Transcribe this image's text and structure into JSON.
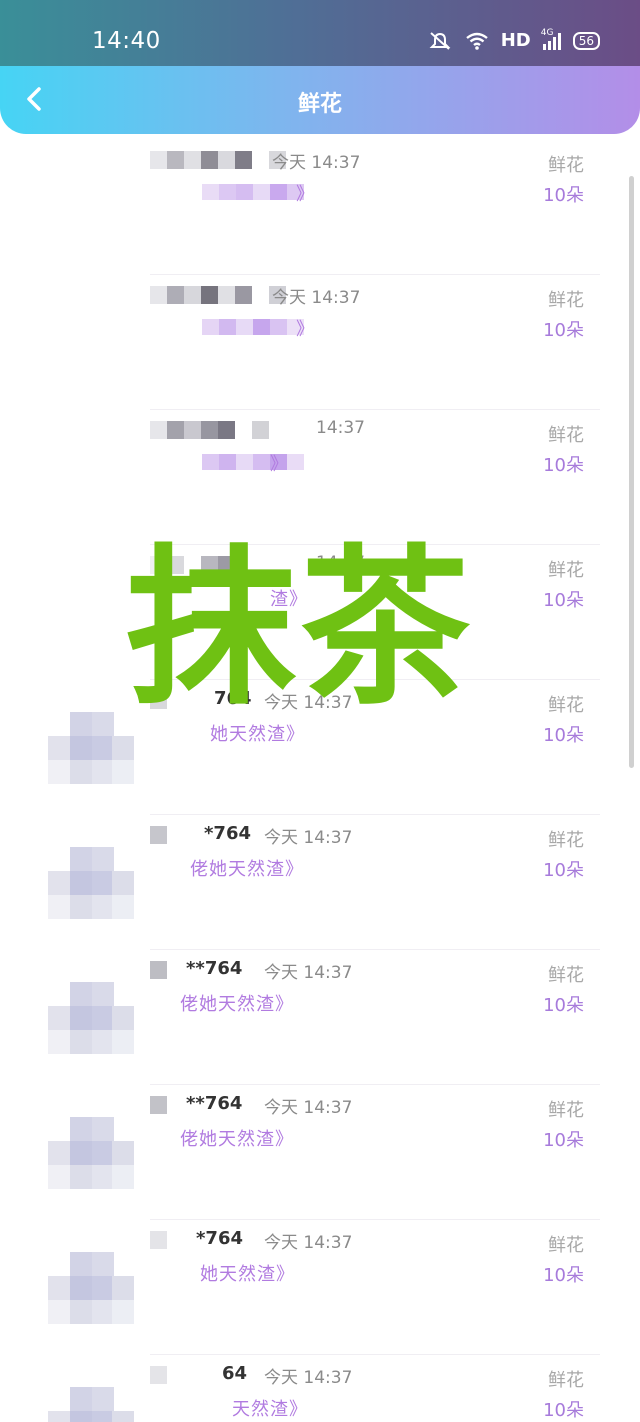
{
  "status_bar": {
    "time": "14:40",
    "network": "HD",
    "signal_label": "4G",
    "battery": "56"
  },
  "nav": {
    "title": "鲜花"
  },
  "records": [
    {
      "name": "",
      "time": "今天 14:37",
      "message": "》",
      "gift_name": "鲜花",
      "gift_count": "10朵"
    },
    {
      "name": "",
      "time": "今天 14:37",
      "message": "》",
      "gift_name": "鲜花",
      "gift_count": "10朵"
    },
    {
      "name": "",
      "time": "14:37",
      "message": "》",
      "gift_name": "鲜花",
      "gift_count": "10朵"
    },
    {
      "name": "",
      "time": "14:37",
      "message": "渣》",
      "gift_name": "鲜花",
      "gift_count": "10朵"
    },
    {
      "name": "764",
      "time": "今天 14:37",
      "message": "她天然渣》",
      "gift_name": "鲜花",
      "gift_count": "10朵"
    },
    {
      "name": "*764",
      "time": "今天 14:37",
      "message": "佬她天然渣》",
      "gift_name": "鲜花",
      "gift_count": "10朵"
    },
    {
      "name": "**764",
      "time": "今天 14:37",
      "message": "佬她天然渣》",
      "gift_name": "鲜花",
      "gift_count": "10朵"
    },
    {
      "name": "**764",
      "time": "今天 14:37",
      "message": "佬她天然渣》",
      "gift_name": "鲜花",
      "gift_count": "10朵"
    },
    {
      "name": "*764",
      "time": "今天 14:37",
      "message": "她天然渣》",
      "gift_name": "鲜花",
      "gift_count": "10朵"
    },
    {
      "name": "64",
      "time": "今天 14:37",
      "message": "天然渣》",
      "gift_name": "鲜花",
      "gift_count": "10朵"
    }
  ],
  "watermark": "抹茶",
  "colors": {
    "accent": "#b17be0",
    "watermark": "#6fc113"
  }
}
